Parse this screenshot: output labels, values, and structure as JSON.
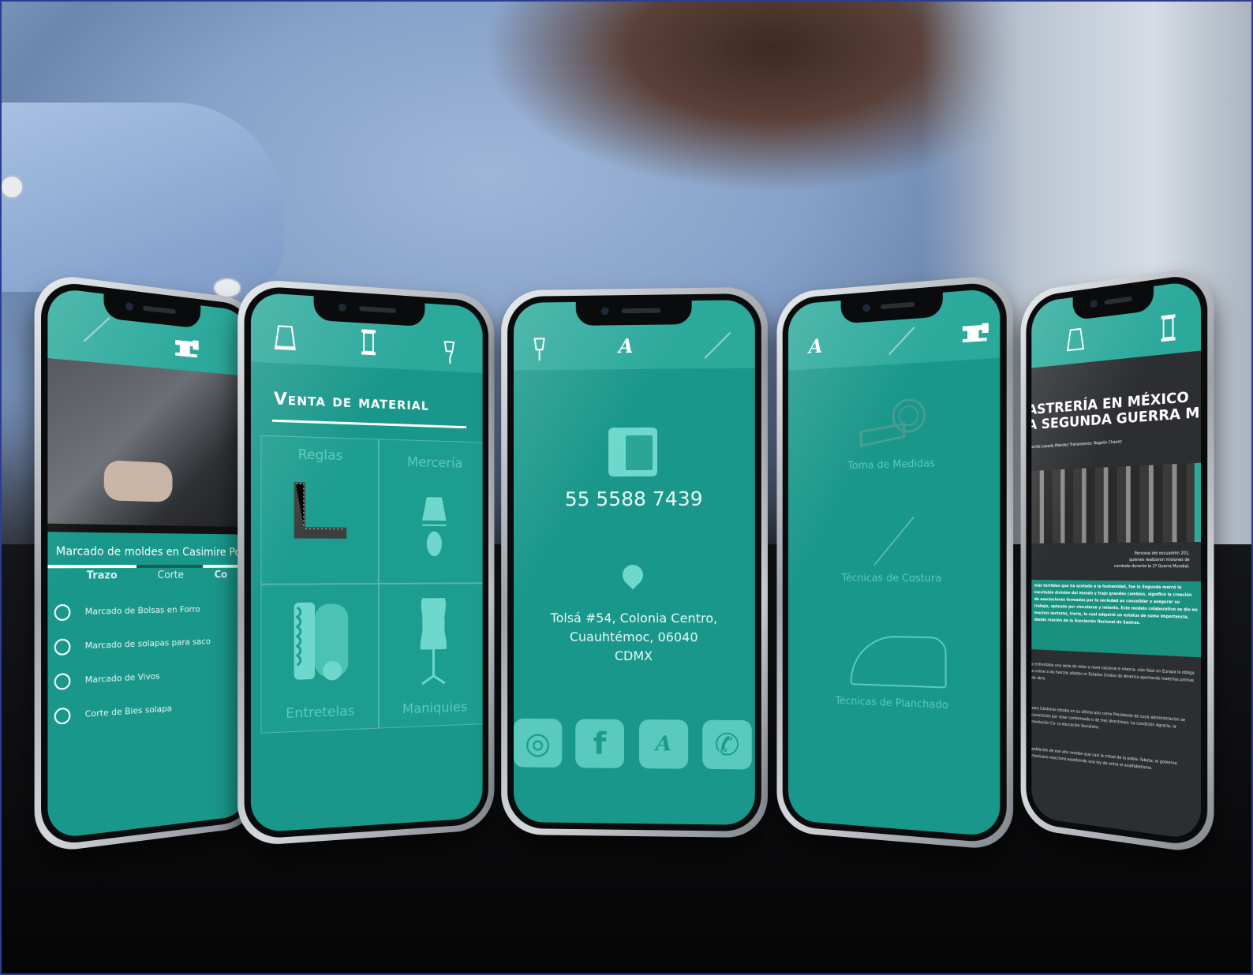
{
  "colors": {
    "teal": "#18978a",
    "teal_bar": "#2ba99b",
    "teal_light": "#5cc9bd",
    "dark": "#2c2e31"
  },
  "phone1": {
    "top_icons": [
      "slash-icon",
      "sewing-machine-icon"
    ],
    "video_title": "Marcado de moldes en Casimire Pol",
    "tabs": [
      "Trazo",
      "Corte",
      "Co"
    ],
    "items": [
      "Marcado de Bolsas en Forro",
      "Marcado de solapas para saco",
      "Marcado de Vivos",
      "Corte de Bies solapa"
    ]
  },
  "phone2": {
    "top_icons": [
      "thimble-icon",
      "spool-icon",
      "mannequin-icon"
    ],
    "heading": "Venta de material",
    "cells": {
      "reglas": "Reglas",
      "merceria": "Mercería",
      "entretelas": "Entretelas",
      "maniquies": "Maniquies"
    }
  },
  "phone3": {
    "top_icons": [
      "mannequin-icon",
      "logo-icon",
      "slash-icon"
    ],
    "phone_number": "55 5588 7439",
    "address_lines": [
      "Tolsá #54, Colonia Centro,",
      "Cuauhtémoc, 06040",
      "CDMX"
    ],
    "social": [
      "instagram-icon",
      "facebook-icon",
      "logo-icon",
      "whatsapp-icon"
    ],
    "social_glyphs": [
      "◎",
      "f",
      "A",
      "✆"
    ]
  },
  "phone4": {
    "top_icons": [
      "logo-icon",
      "slash-icon",
      "sewing-machine-icon"
    ],
    "items": [
      "Toma de Medidas",
      "Técnicas de Costura",
      "Técnicas de Planchado"
    ]
  },
  "phone5": {
    "top_icons": [
      "thimble-icon",
      "spool-icon"
    ],
    "title_lines": [
      "ASTRERÍA EN MÉXICO",
      "A SEGUNDA GUERRA MUNDIAL"
    ],
    "credits": "ecilia Lozada Mandez   Tratamiento: Rogelio Chavez",
    "caption_lines": [
      "Personal del escuadrón 201,",
      "quienes realizaron misiones de",
      "combate durante la 2ª Guerra Mundial."
    ],
    "para1": "más terribles que ha azotado a la humanidad, fue la Segunda marcó la inevitable división del mundo y trajo grandes cambios, significó la creación de asociaciones formadas por la sociedad an consolidar y asegurar su trabajo, optando por vincularse y imiento. Este modelo colaborativo se dio en muchos sectores, trería, la cual adquirió un estatus de suma importancia, dando reación de la Asociación Nacional de Sastres.",
    "para2": "o enfrentaba una serie de retos a nivel nacional e interna- sión Nazi en Europa lo obliga a unirse a las fuerzas aliadas or Estados Unidos de América aportando materias primas de obra.",
    "para3": "zaro Cárdenas estaba en su último año como Presidente de cuya administración se caracterizó por estar conformado e de tres directrices: La condición Agraria, la revolución Ca- la educación Socialista.",
    "para4": "población de ese año revelan que casi la mitad de la pobla- fabeta, el gobierno mexicano reaccionó expidiendo una ley de ontra el analfabetismo."
  }
}
